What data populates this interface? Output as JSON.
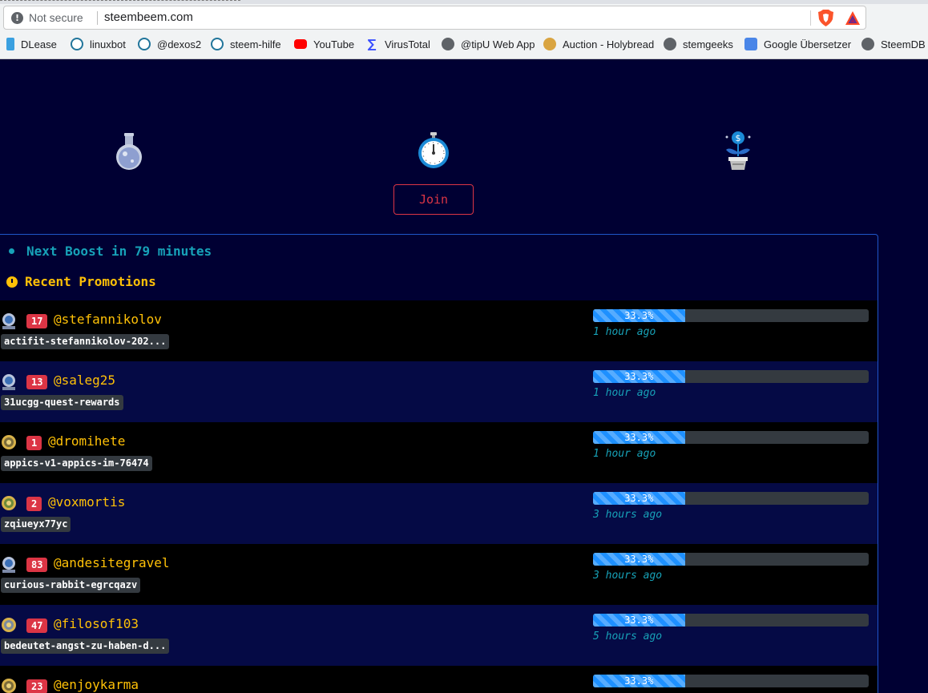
{
  "browser": {
    "security_label": "Not secure",
    "url": "steembeem.com",
    "bookmarks": [
      {
        "label": "DLease",
        "icon": "dlease-icon"
      },
      {
        "label": "linuxbot",
        "icon": "wordpress-icon"
      },
      {
        "label": "@dexos2",
        "icon": "wordpress-icon"
      },
      {
        "label": "steem-hilfe",
        "icon": "wordpress-icon"
      },
      {
        "label": "YouTube",
        "icon": "youtube-icon"
      },
      {
        "label": "VirusTotal",
        "icon": "virustotal-icon"
      },
      {
        "label": "@tipU Web App",
        "icon": "globe-icon"
      },
      {
        "label": "Auction - Holybread",
        "icon": "bread-icon"
      },
      {
        "label": "stemgeeks",
        "icon": "globe-icon"
      },
      {
        "label": "Google Übersetzer",
        "icon": "google-translate-icon"
      },
      {
        "label": "SteemDB -",
        "icon": "globe-icon"
      }
    ]
  },
  "hero": {
    "icons": [
      "flask-icon",
      "stopwatch-icon",
      "money-plant-icon"
    ],
    "join_label": "Join"
  },
  "panel": {
    "next_boost": "Next Boost in 79 minutes",
    "recent_title": "Recent Promotions",
    "rows": [
      {
        "rank": "17",
        "user": "@stefannikolov",
        "permlink": "actifit-stefannikolov-202...",
        "progress_label": "33.3%",
        "progress": 0.333,
        "time": "1 hour ago",
        "badge": "silver-badge-icon"
      },
      {
        "rank": "13",
        "user": "@saleg25",
        "permlink": "31ucgg-quest-rewards",
        "progress_label": "33.3%",
        "progress": 0.333,
        "time": "1 hour ago",
        "badge": "silver-badge-icon"
      },
      {
        "rank": "1",
        "user": "@dromihete",
        "permlink": "appics-v1-appics-im-76474",
        "progress_label": "33.3%",
        "progress": 0.333,
        "time": "1 hour ago",
        "badge": "gold-badge-icon"
      },
      {
        "rank": "2",
        "user": "@voxmortis",
        "permlink": "zqiueyx77yc",
        "progress_label": "33.3%",
        "progress": 0.333,
        "time": "3 hours ago",
        "badge": "gold-badge-icon"
      },
      {
        "rank": "83",
        "user": "@andesitegravel",
        "permlink": "curious-rabbit-egrcqazv",
        "progress_label": "33.3%",
        "progress": 0.333,
        "time": "3 hours ago",
        "badge": "silver-badge-icon"
      },
      {
        "rank": "47",
        "user": "@filosof103",
        "permlink": "bedeutet-angst-zu-haben-d...",
        "progress_label": "33.3%",
        "progress": 0.333,
        "time": "5 hours ago",
        "badge": "gold-badge-icon"
      },
      {
        "rank": "23",
        "user": "@enjoykarma",
        "permlink": "",
        "progress_label": "33.3%",
        "progress": 0.333,
        "time": "",
        "badge": "gold-badge-icon"
      }
    ]
  },
  "colors": {
    "background": "#000033",
    "accent_yellow": "#ffc107",
    "accent_cyan": "#17a2b8",
    "danger": "#dc3545",
    "progress_fill": "#1e90ff"
  }
}
